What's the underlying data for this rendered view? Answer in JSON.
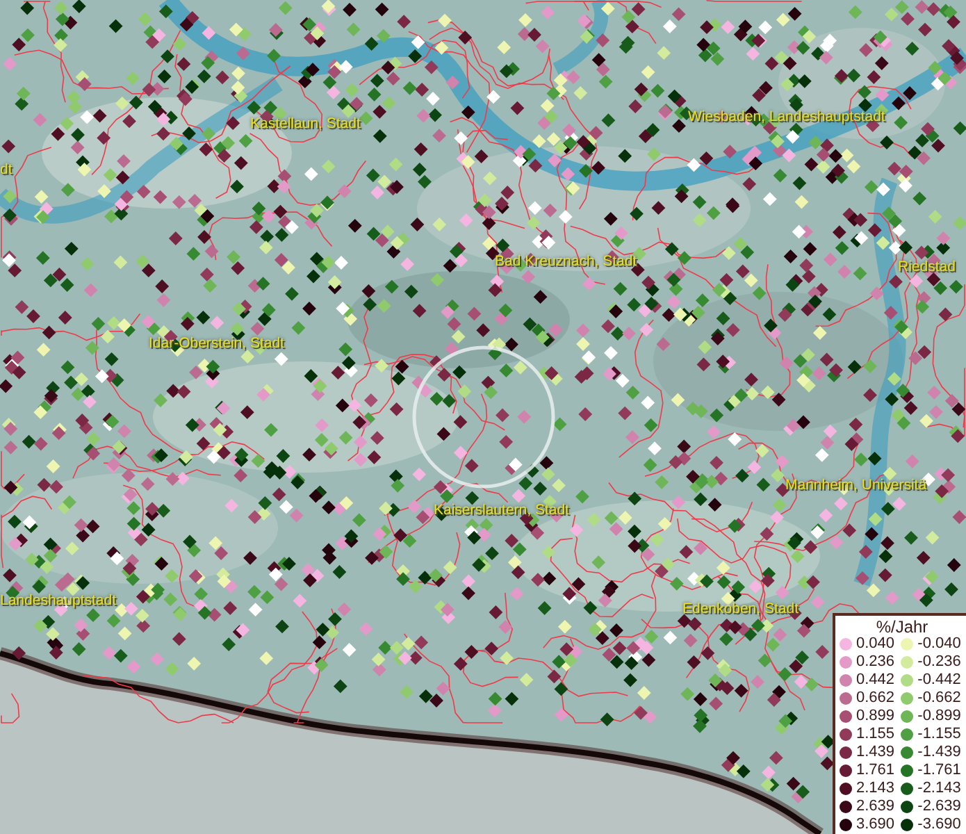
{
  "map": {
    "places": [
      {
        "name": "Kastellaun, Stadt"
      },
      {
        "name": "Wiesbaden, Landeshauptstadt"
      },
      {
        "name": "dt"
      },
      {
        "name": "Bad Kreuznach, Stadt"
      },
      {
        "name": "Riedstad"
      },
      {
        "name": "Idar-Oberstein, Stadt"
      },
      {
        "name": "Mannheim, Universitä"
      },
      {
        "name": "Kaiserslautern, Stadt"
      },
      {
        "name": "Landeshauptstadt"
      },
      {
        "name": "Edenkoben, Stadt"
      }
    ]
  },
  "legend": {
    "title": "%/Jahr",
    "positive": [
      {
        "value": "0.040",
        "color": "#f4b6e0"
      },
      {
        "value": "0.236",
        "color": "#e49ac8"
      },
      {
        "value": "0.442",
        "color": "#d083ad"
      },
      {
        "value": "0.662",
        "color": "#bb6b90"
      },
      {
        "value": "0.899",
        "color": "#a64f72"
      },
      {
        "value": "1.155",
        "color": "#913a5a"
      },
      {
        "value": "1.439",
        "color": "#7b2844"
      },
      {
        "value": "1.761",
        "color": "#661a33"
      },
      {
        "value": "2.143",
        "color": "#4f0f22"
      },
      {
        "value": "2.639",
        "color": "#3a0816"
      },
      {
        "value": "3.690",
        "color": "#25030c"
      }
    ],
    "negative": [
      {
        "value": "-0.040",
        "color": "#eef5b0"
      },
      {
        "value": "-0.236",
        "color": "#d3eb9c"
      },
      {
        "value": "-0.442",
        "color": "#b1dc86"
      },
      {
        "value": "-0.662",
        "color": "#8fcb6d"
      },
      {
        "value": "-0.899",
        "color": "#6eb657"
      },
      {
        "value": "-1.155",
        "color": "#4fa042"
      },
      {
        "value": "-1.439",
        "color": "#388a32"
      },
      {
        "value": "-1.761",
        "color": "#257325"
      },
      {
        "value": "-2.143",
        "color": "#175c1a"
      },
      {
        "value": "-2.639",
        "color": "#0c4512"
      },
      {
        "value": "-3.690",
        "color": "#053009"
      }
    ]
  }
}
